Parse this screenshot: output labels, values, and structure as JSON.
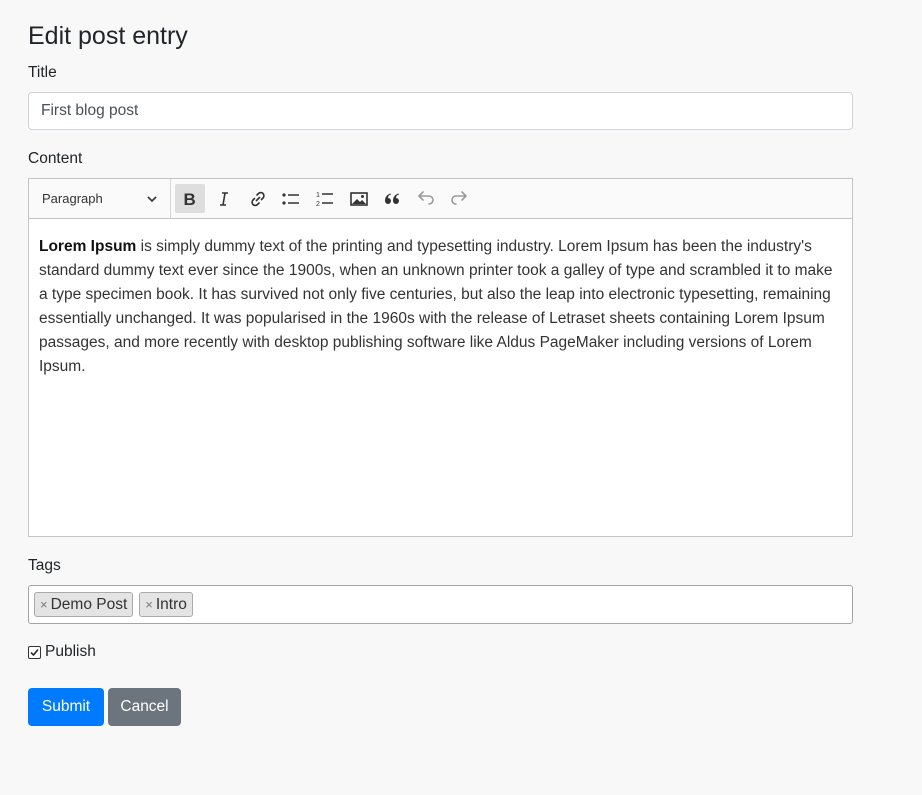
{
  "page": {
    "title": "Edit post entry"
  },
  "title_field": {
    "label": "Title",
    "value": "First blog post"
  },
  "content_field": {
    "label": "Content",
    "heading_select": "Paragraph",
    "toolbar": [
      "bold",
      "italic",
      "link",
      "bulleted-list",
      "numbered-list",
      "image",
      "block-quote",
      "undo",
      "redo"
    ],
    "bold_lead": "Lorem Ipsum",
    "body": " is simply dummy text of the printing and typesetting industry. Lorem Ipsum has been the industry's standard dummy text ever since the 1900s, when an unknown printer took a galley of type and scrambled it to make a type specimen book. It has survived not only five centuries, but also the leap into electronic typesetting, remaining essentially unchanged. It was popularised in the 1960s with the release of Letraset sheets containing Lorem Ipsum passages, and more recently with desktop publishing software like Aldus PageMaker including versions of Lorem Ipsum."
  },
  "tags_field": {
    "label": "Tags",
    "remove_glyph": "×",
    "tags": [
      "Demo Post",
      "Intro"
    ]
  },
  "publish": {
    "label": "Publish",
    "checked": true
  },
  "actions": {
    "submit_label": "Submit",
    "cancel_label": "Cancel"
  },
  "colors": {
    "primary": "#007bff",
    "secondary": "#6c757d",
    "background": "#f8f8f8"
  }
}
